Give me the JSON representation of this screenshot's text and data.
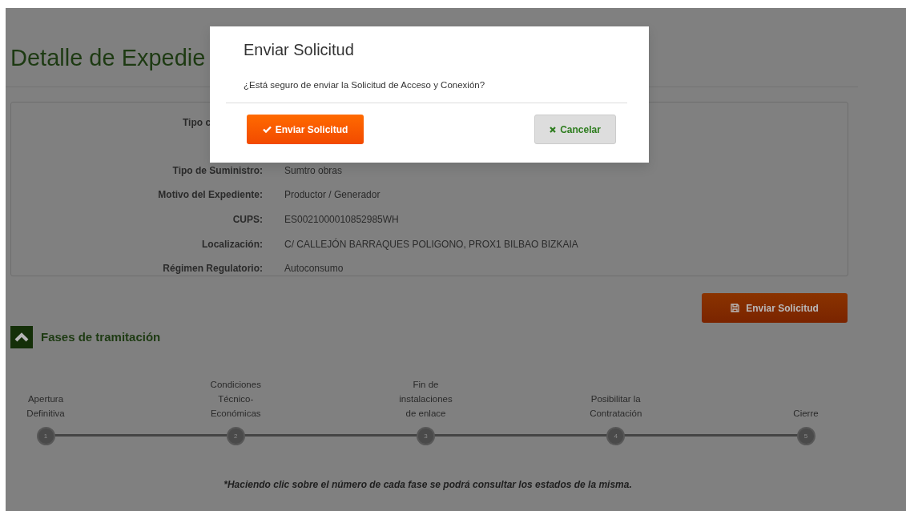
{
  "page": {
    "title": "Detalle de Expedie"
  },
  "details": [
    {
      "label": "Tipo c"
    },
    {
      "label": "Tipo de Suministro:",
      "value": "Sumtro obras"
    },
    {
      "label": "Motivo del Expediente:",
      "value": "Productor / Generador"
    },
    {
      "label": "CUPS:",
      "value": "ES0021000010852985WH"
    },
    {
      "label": "Localización:",
      "value": "C/ CALLEJÓN BARRAQUES POLIGONO, PROX1 BILBAO BIZKAIA"
    },
    {
      "label": "Régimen Regulatorio:",
      "value": "Autoconsumo"
    }
  ],
  "action_button": {
    "label": "Enviar Solicitud"
  },
  "section": {
    "title": "Fases de tramitación",
    "expanded": true
  },
  "phases": [
    {
      "number": "1",
      "label": "Apertura\nDefinitiva"
    },
    {
      "number": "2",
      "label": "Condiciones\nTécnico-\nEconómicas"
    },
    {
      "number": "3",
      "label": "Fin de\ninstalaciones\nde enlace"
    },
    {
      "number": "4",
      "label": "Posibilitar la\nContratación"
    },
    {
      "number": "5",
      "label": "Cierre"
    }
  ],
  "footnote": "*Haciendo clic sobre el número de cada fase se podrá consultar los estados de la misma.",
  "modal": {
    "title": "Enviar Solicitud",
    "message": "¿Está seguro de enviar la Solicitud de Acceso y Conexión?",
    "confirm_button": "Enviar Solicitud",
    "cancel_button": "Cancelar"
  }
}
